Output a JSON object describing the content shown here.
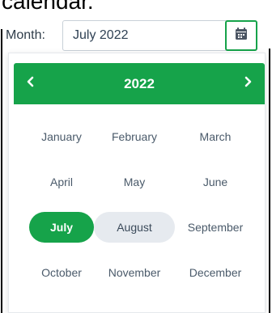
{
  "caption": "calendar.",
  "field": {
    "label": "Month:",
    "value": "July 2022",
    "button_icon": "calendar-icon"
  },
  "picker": {
    "year": "2022",
    "prev_icon": "chevron-left-icon",
    "next_icon": "chevron-right-icon",
    "accent_color": "#16a34a",
    "selected_month": "July",
    "hovered_month": "August",
    "months": [
      "January",
      "February",
      "March",
      "April",
      "May",
      "June",
      "July",
      "August",
      "September",
      "October",
      "November",
      "December"
    ]
  }
}
